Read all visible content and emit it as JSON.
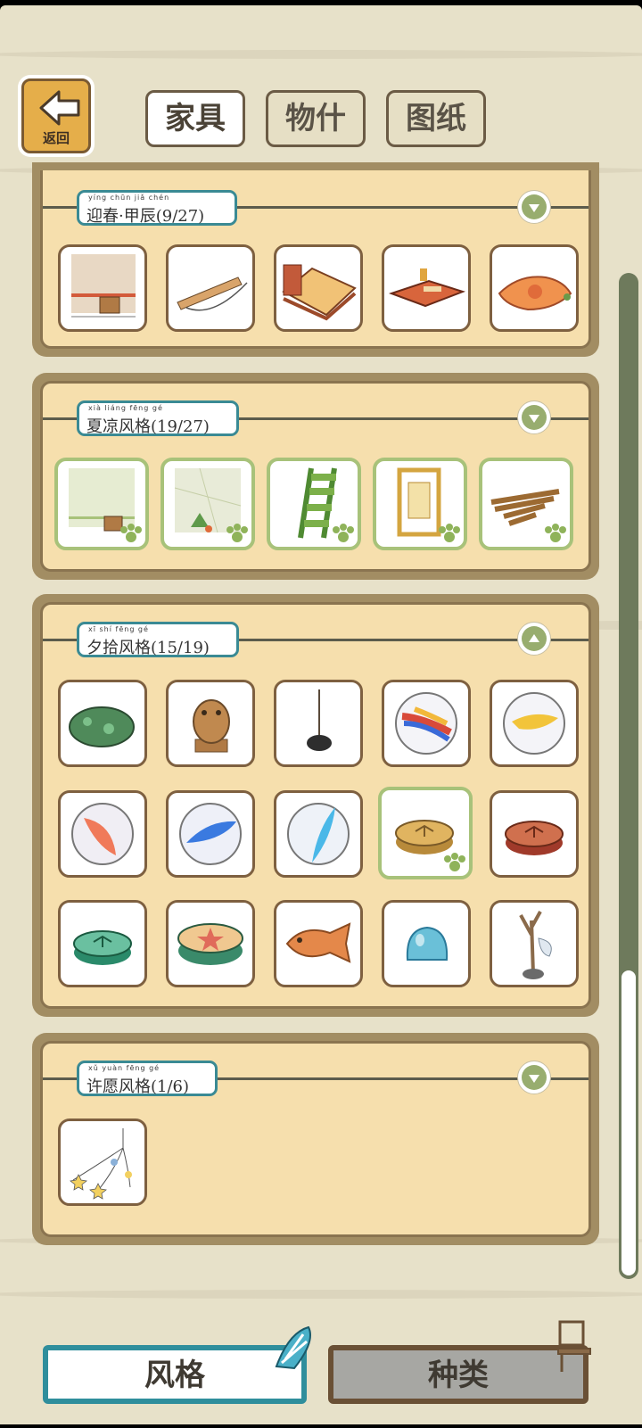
{
  "back": {
    "label": "返回"
  },
  "top_tabs": [
    {
      "label": "家具",
      "active": true
    },
    {
      "label": "物什",
      "active": false
    },
    {
      "label": "图纸",
      "active": false
    }
  ],
  "panels": [
    {
      "pinyin": "yíng chūn  jiǎ chén",
      "title": "迎春·甲辰(9/27)",
      "expanded": false,
      "items": [
        "wall-scroll-bucket-icon",
        "bamboo-flute-icon",
        "wooden-bed-icon",
        "low-table-icon",
        "orange-cushion-icon"
      ]
    },
    {
      "pinyin": "xià liáng fēng gé",
      "title": "夏凉风格(19/27)",
      "expanded": false,
      "items": [
        "bamboo-wall-icon",
        "tatami-floor-icon",
        "bamboo-ladder-icon",
        "bamboo-door-frame-icon",
        "bamboo-bundle-icon"
      ]
    },
    {
      "pinyin": "xī shí fēng gé",
      "title": "夕拾风格(15/19)",
      "expanded": true,
      "items": [
        "green-frog-stone-icon",
        "stone-frog-statue-icon",
        "stick-stand-icon",
        "rainbow-marble-icon",
        "yellow-marble-icon",
        "orange-marble-icon",
        "blue-marble-icon",
        "cyan-marble-icon",
        "tan-checker-piece-icon",
        "red-checker-piece-icon",
        "green-checker-piece-icon",
        "star-drum-icon",
        "taiyaki-fish-icon",
        "blue-jelly-icon",
        "branch-stand-icon"
      ]
    },
    {
      "pinyin": "xǔ yuàn fēng gé",
      "title": "许愿风格(1/6)",
      "expanded": false,
      "items": [
        "star-chime-icon"
      ]
    }
  ],
  "bottom_tabs": [
    {
      "label": "风格",
      "active": true
    },
    {
      "label": "种类",
      "active": false
    }
  ],
  "colors": {
    "accent_teal": "#2f8e9c",
    "owned_green": "#a8c27a",
    "panel_bg": "#f6dfad",
    "wood_brown": "#7e6040"
  }
}
